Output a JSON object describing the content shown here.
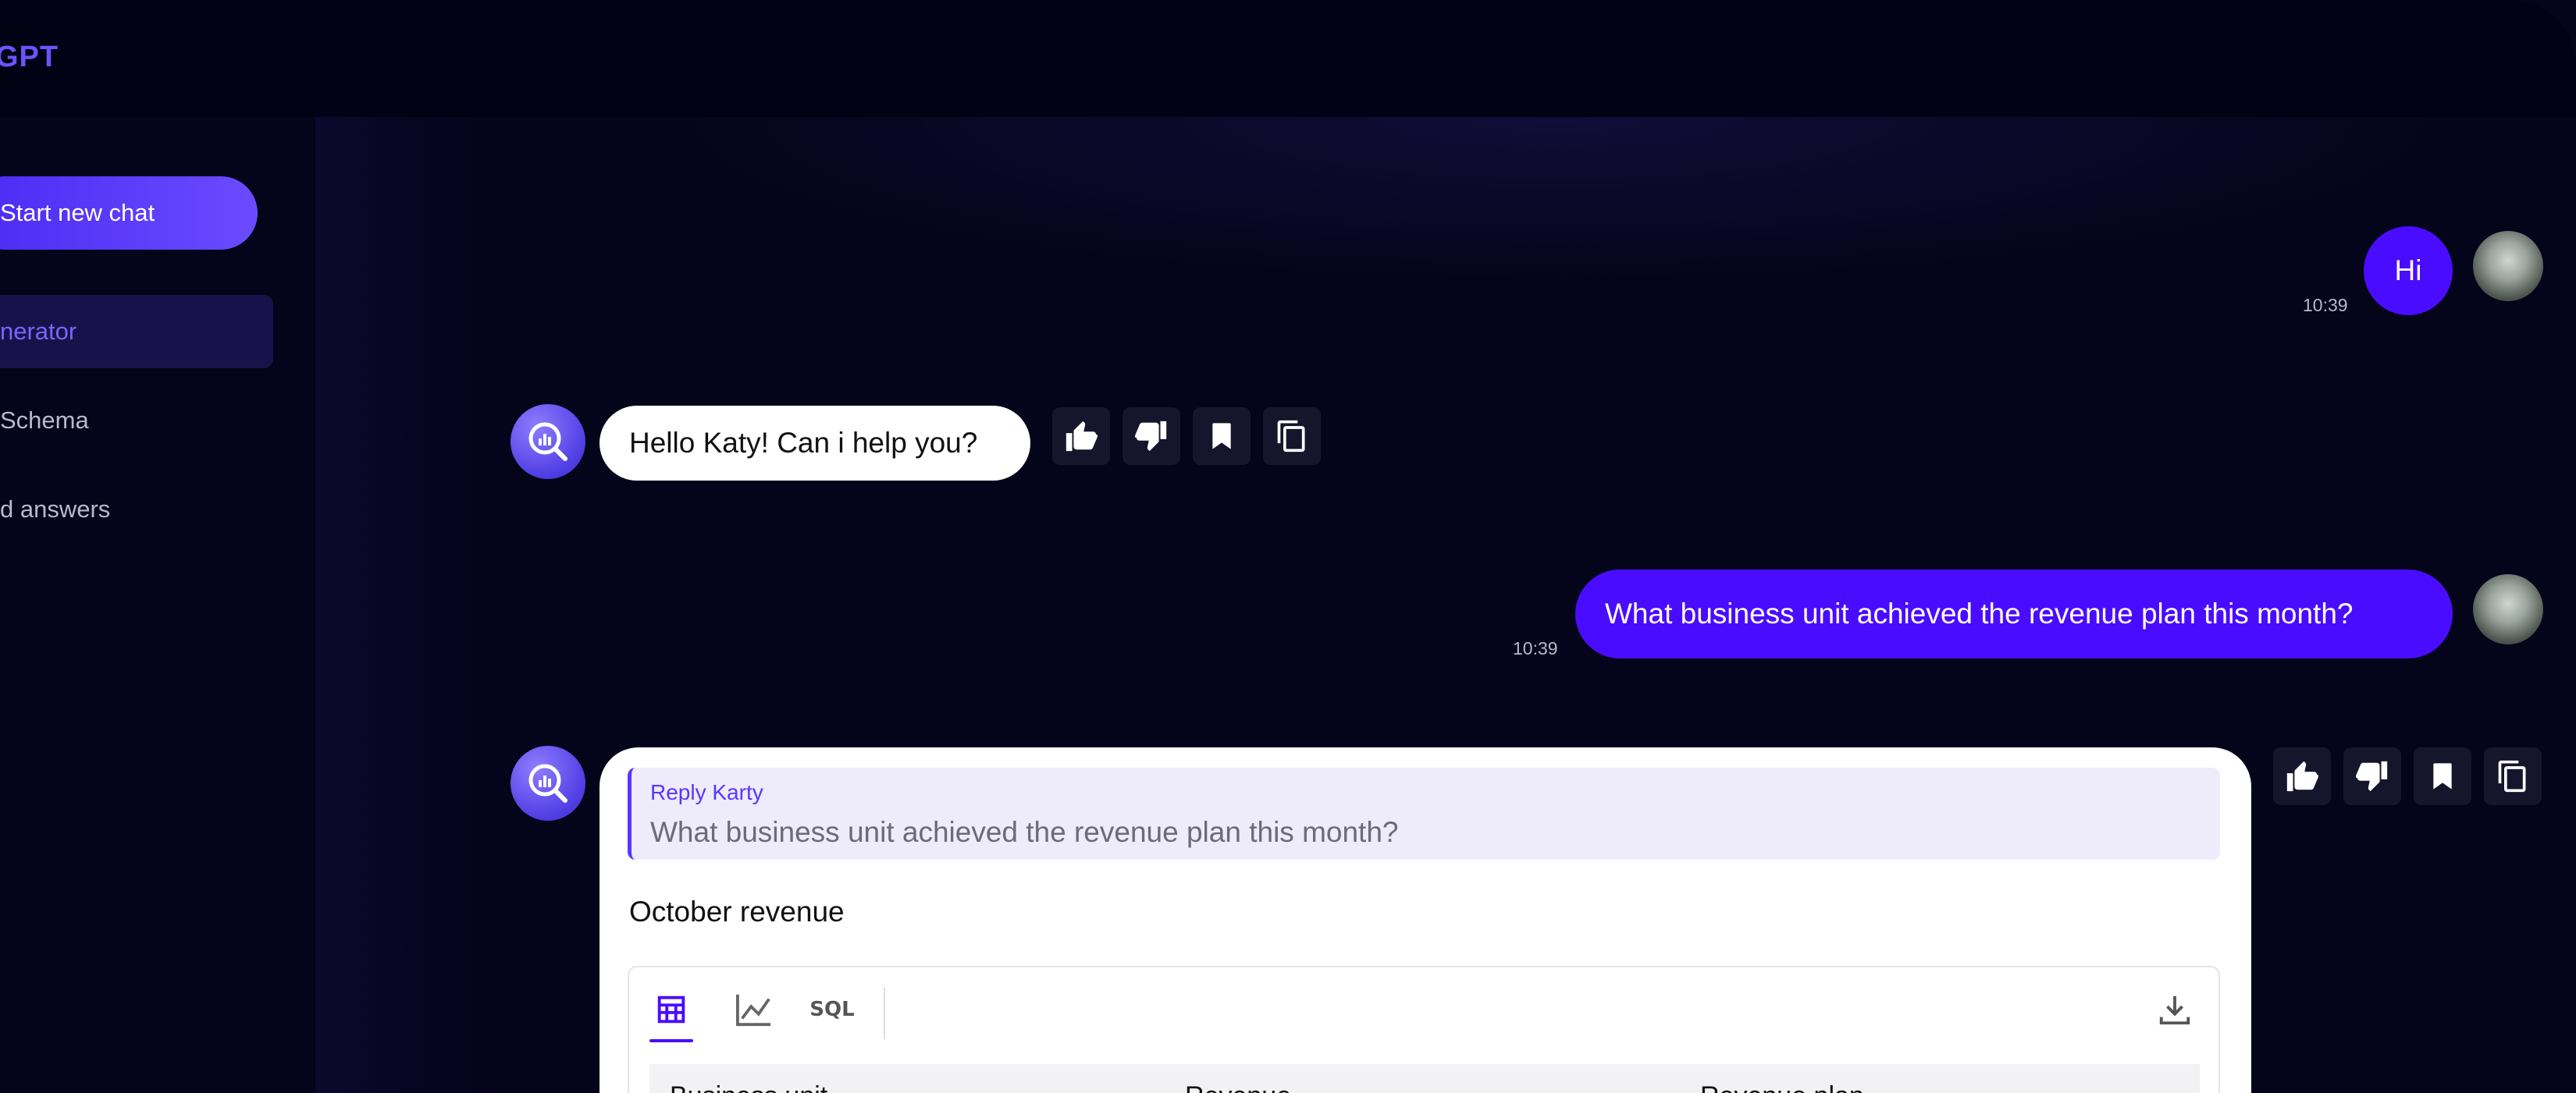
{
  "brand": {
    "name": "GPT"
  },
  "sidebar": {
    "new_chat_label": "Start new chat",
    "items": [
      {
        "label": "nerator",
        "active": true
      },
      {
        "label": "Schema",
        "active": false
      },
      {
        "label": "d answers",
        "active": false
      }
    ]
  },
  "chat": {
    "messages": [
      {
        "role": "user",
        "text": "Hi",
        "time": "10:39"
      },
      {
        "role": "bot",
        "text": "Hello Katy! Can i help you?"
      },
      {
        "role": "user",
        "text": "What business unit achieved the revenue plan this month?",
        "time": "10:39"
      },
      {
        "role": "bot",
        "reply_label": "Reply Karty",
        "reply_text": "What business unit achieved the revenue plan this month?",
        "title": "October revenue",
        "tabs": [
          {
            "name": "table-icon",
            "active": true
          },
          {
            "name": "chart-line-icon",
            "active": false
          },
          {
            "label": "SQL",
            "active": false
          }
        ],
        "table_headers": [
          "Business unit",
          "Revenue",
          "Revenue plan"
        ]
      }
    ]
  },
  "icons": [
    "thumbs-up-icon",
    "thumbs-down-icon",
    "bookmark-icon",
    "copy-icon",
    "download-icon"
  ],
  "colors": {
    "accent": "#4a0cff",
    "brand": "#6d52ff",
    "background": "#04041a"
  }
}
